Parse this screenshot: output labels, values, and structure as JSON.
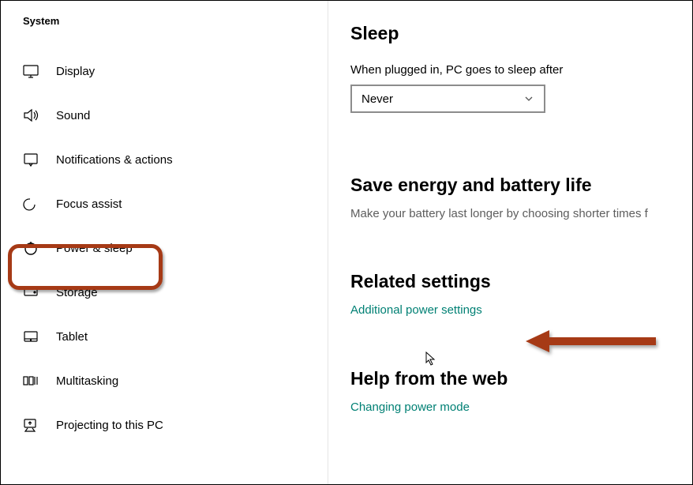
{
  "sidebar": {
    "title": "System",
    "items": [
      {
        "label": "Display",
        "icon": "display-icon"
      },
      {
        "label": "Sound",
        "icon": "sound-icon"
      },
      {
        "label": "Notifications & actions",
        "icon": "notifications-icon"
      },
      {
        "label": "Focus assist",
        "icon": "focus-assist-icon"
      },
      {
        "label": "Power & sleep",
        "icon": "power-icon",
        "selected": true
      },
      {
        "label": "Storage",
        "icon": "storage-icon"
      },
      {
        "label": "Tablet",
        "icon": "tablet-icon"
      },
      {
        "label": "Multitasking",
        "icon": "multitasking-icon"
      },
      {
        "label": "Projecting to this PC",
        "icon": "projecting-icon"
      }
    ]
  },
  "main": {
    "sleep": {
      "heading": "Sleep",
      "field_label": "When plugged in, PC goes to sleep after",
      "dropdown_value": "Never"
    },
    "energy": {
      "heading": "Save energy and battery life",
      "subtext": "Make your battery last longer by choosing shorter times f"
    },
    "related": {
      "heading": "Related settings",
      "link": "Additional power settings"
    },
    "help": {
      "heading": "Help from the web",
      "link": "Changing power mode"
    }
  },
  "annotations": {
    "highlight_target": "Power & sleep",
    "arrow_color": "#a63a16"
  }
}
